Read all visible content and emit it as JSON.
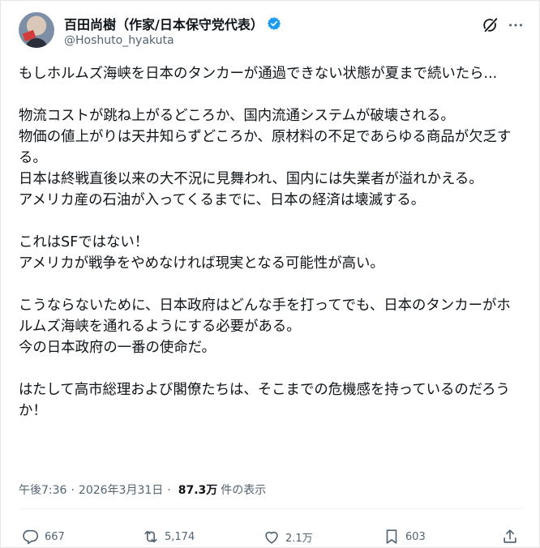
{
  "author": {
    "display_name": "百田尚樹（作家/日本保守党代表）",
    "handle": "@Hoshuto_hyakuta",
    "verified": true
  },
  "tweet": {
    "text": "もしホルムズ海峡を日本のタンカーが通過できない状態が夏まで続いたら...\n\n物流コストが跳ね上がるどころか、国内流通システムが破壊される。\n物価の値上がりは天井知らずどころか、原材料の不足であらゆる商品が欠乏する。\n日本は終戦直後以来の大不況に見舞われ、国内には失業者が溢れかえる。\nアメリカ産の石油が入ってくるまでに、日本の経済は壊滅する。\n\nこれはSFではない！\nアメリカが戦争をやめなければ現実となる可能性が高い。\n\nこうならないために、日本政府はどんな手を打ってでも、日本のタンカーがホルムズ海峡を通れるようにする必要がある。\n今の日本政府の一番の使命だ。\n\nはたして高市総理および閣僚たちは、そこまでの危機感を持っているのだろうか！"
  },
  "meta": {
    "time": "午後7:36",
    "date": "2026年3月31日",
    "separator": "·",
    "views_count": "87.3万",
    "views_label": "件の表示"
  },
  "actions": {
    "replies": "667",
    "reposts": "5,174",
    "likes": "2.1万",
    "bookmarks": "603"
  },
  "colors": {
    "verified": "#1d9bf0",
    "secondary_text": "#536471",
    "primary_text": "#0f1419"
  }
}
